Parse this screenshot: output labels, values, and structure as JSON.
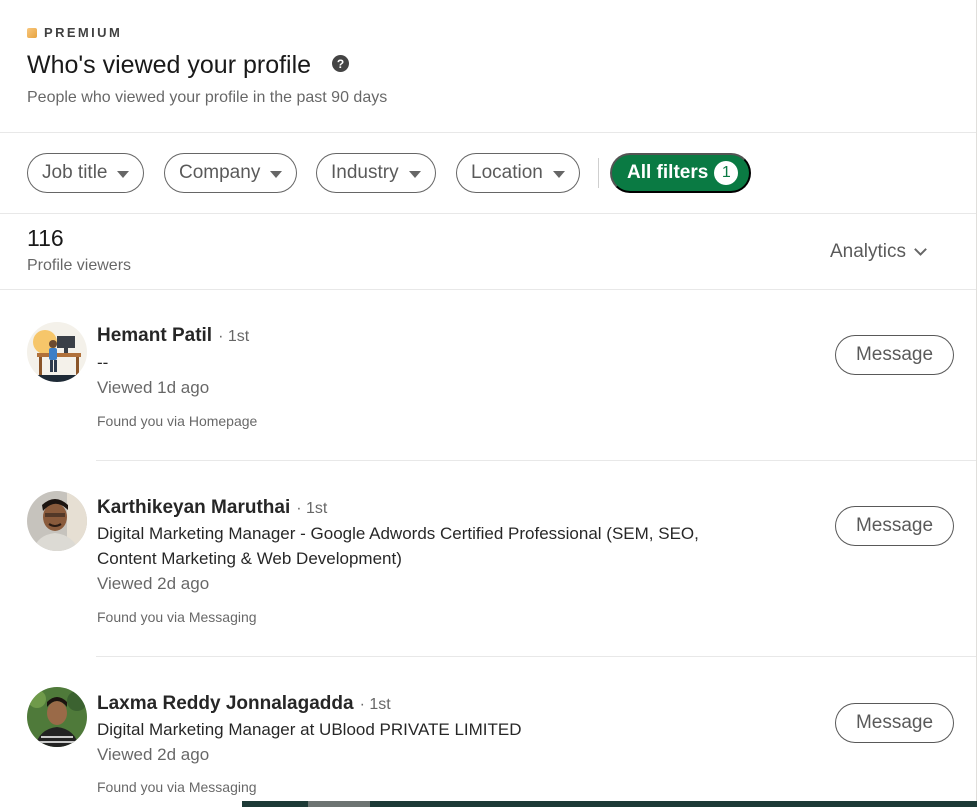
{
  "header": {
    "premium_label": "PREMIUM",
    "title": "Who's viewed your profile",
    "help_glyph": "?",
    "subtitle": "People who viewed your profile in the past 90 days"
  },
  "filters": {
    "items": [
      {
        "label": "Job title"
      },
      {
        "label": "Company"
      },
      {
        "label": "Industry"
      },
      {
        "label": "Location"
      }
    ],
    "all_filters_label": "All filters",
    "all_filters_count": "1"
  },
  "stats": {
    "count": "116",
    "label": "Profile viewers",
    "analytics_label": "Analytics"
  },
  "viewers": [
    {
      "name": "Hemant Patil",
      "degree": "· 1st",
      "headline": "--",
      "viewed": "Viewed 1d ago",
      "found_via": "Found you via Homepage",
      "button": "Message",
      "avatar_icon": "person-at-desk-illustration"
    },
    {
      "name": "Karthikeyan Maruthai",
      "degree": "· 1st",
      "headline": "Digital Marketing Manager - Google Adwords Certified Professional (SEM, SEO, Content Marketing & Web Development)",
      "viewed": "Viewed 2d ago",
      "found_via": "Found you via Messaging",
      "button": "Message",
      "avatar_icon": "profile-photo"
    },
    {
      "name": "Laxma Reddy Jonnalagadda",
      "degree": "· 1st",
      "headline": "Digital Marketing Manager at UBlood PRIVATE LIMITED",
      "viewed": "Viewed 2d ago",
      "found_via": "Found you via Messaging",
      "button": "Message",
      "avatar_icon": "profile-photo"
    }
  ],
  "colors": {
    "brand_green": "#0a7a43",
    "premium_gold": "#e7a33e"
  }
}
